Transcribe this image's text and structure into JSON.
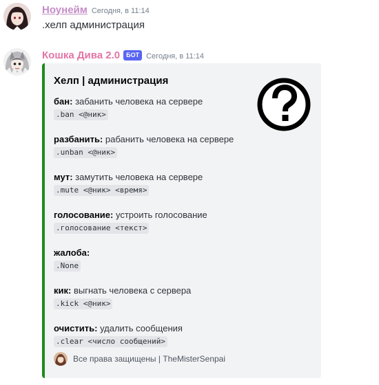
{
  "messages": [
    {
      "username": "Ноунейм",
      "timestamp": "Сегодня, в 11:14",
      "text": ".хелп администрация"
    },
    {
      "username": "Кошка Дива 2.0",
      "bot_tag": "БОТ",
      "timestamp": "Сегодня, в 11:14",
      "embed": {
        "accent_color": "#1e8a1e",
        "title": "Хелп | администрация",
        "thumbnail_icon": "question-mark-icon",
        "fields": [
          {
            "name": "бан:",
            "value": "забанить человека на сервере",
            "code": ".ban <@ник>"
          },
          {
            "name": "разбанить:",
            "value": "рабанить человека на сервере",
            "code": ".unban <@ник>"
          },
          {
            "name": "мут:",
            "value": "замутить человека на сервере",
            "code": ".mute <@ник> <время>"
          },
          {
            "name": "голосование:",
            "value": "устроить голосование",
            "code": ".голосование <текст>"
          },
          {
            "name": "жалоба:",
            "value": "",
            "code": ".None"
          },
          {
            "name": "кик:",
            "value": "выгнать человека с сервера",
            "code": ".kick <@ник>"
          },
          {
            "name": "очистить:",
            "value": "удалить сообщения",
            "code": ".clear <число сообщений>"
          }
        ],
        "footer": "Все права защищены | TheMisterSenpai"
      }
    }
  ]
}
